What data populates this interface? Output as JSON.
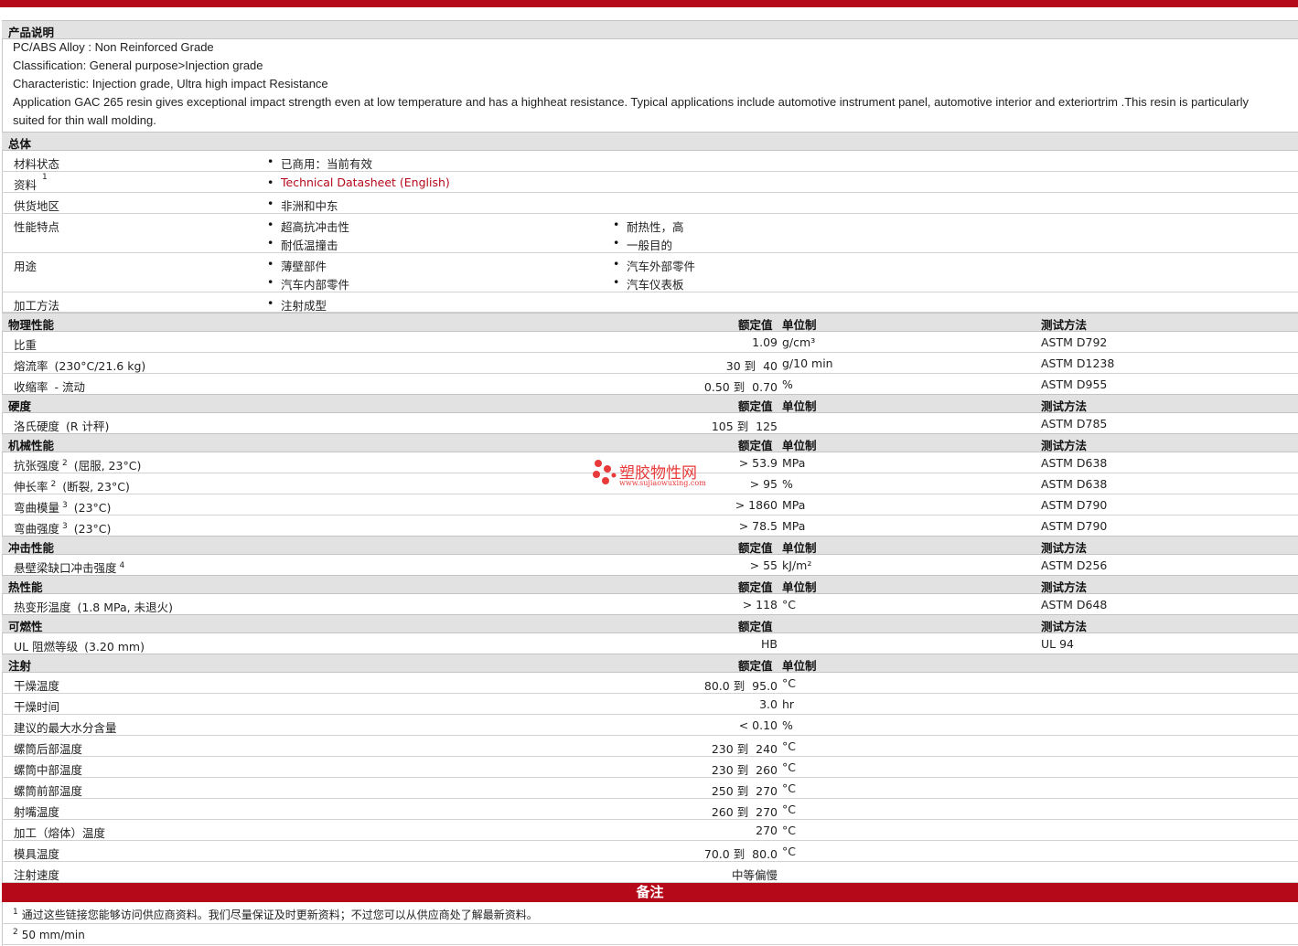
{
  "desc": {
    "header": "产品说明",
    "lines": [
      "PC/ABS Alloy : Non Reinforced Grade",
      "Classification: General purpose>Injection grade",
      "Characteristic: Injection grade, Ultra high impact Resistance",
      "Application GAC 265 resin gives exceptional impact strength even at low temperature and has a highheat resistance. Typical applications include automotive instrument panel, automotive interior and exteriortrim .This resin is particularly",
      "suited for thin wall molding."
    ]
  },
  "general": {
    "header": "总体",
    "rows": [
      {
        "label": "材料状态",
        "items": [
          "已商用：当前有效"
        ]
      },
      {
        "label": "资料",
        "sup": "1",
        "items": [
          "Technical Datasheet (English)"
        ]
      },
      {
        "label": "供货地区",
        "items": [
          "非洲和中东"
        ]
      },
      {
        "label": "性能特点",
        "items": [
          "超高抗冲击性",
          "耐低温撞击",
          "耐热性，高",
          "一般目的"
        ]
      },
      {
        "label": "用途",
        "items": [
          "薄壁部件",
          "汽车内部零件",
          "汽车外部零件",
          "汽车仪表板"
        ]
      },
      {
        "label": "加工方法",
        "items": [
          "注射成型"
        ]
      }
    ]
  },
  "col": {
    "nominal": "额定值",
    "unit": "单位制",
    "method": "测试方法"
  },
  "sections": [
    {
      "name": "物理性能",
      "rows": [
        {
          "label": "比重",
          "sup": "",
          "tail": "",
          "value": "1.09",
          "unit": "g/cm³",
          "method": "ASTM D792"
        },
        {
          "label": "熔流率",
          "sup": "",
          "tail": "(230°C/21.6 kg)",
          "value": "30 到  40",
          "unit": "g/10 min",
          "method": "ASTM D1238"
        },
        {
          "label": "收缩率",
          "sup": "",
          "tail": "- 流动",
          "value": "0.50 到  0.70",
          "unit": "%",
          "method": "ASTM D955"
        }
      ]
    },
    {
      "name": "硬度",
      "rows": [
        {
          "label": "洛氏硬度",
          "sup": "",
          "tail": "(R 计秤)",
          "value": "105 到  125",
          "unit": "",
          "method": "ASTM D785"
        }
      ]
    },
    {
      "name": "机械性能",
      "rows": [
        {
          "label": "抗张强度",
          "sup": "2",
          "tail": "(屈服, 23°C)",
          "value": "> 53.9",
          "unit": "MPa",
          "method": "ASTM D638"
        },
        {
          "label": "伸长率",
          "sup": "2",
          "tail": "(断裂, 23°C)",
          "value": "> 95",
          "unit": "%",
          "method": "ASTM D638"
        },
        {
          "label": "弯曲模量",
          "sup": "3",
          "tail": "(23°C)",
          "value": "> 1860",
          "unit": "MPa",
          "method": "ASTM D790"
        },
        {
          "label": "弯曲强度",
          "sup": "3",
          "tail": "(23°C)",
          "value": "> 78.5",
          "unit": "MPa",
          "method": "ASTM D790"
        }
      ]
    },
    {
      "name": "冲击性能",
      "rows": [
        {
          "label": "悬壁梁缺口冲击强度",
          "sup": "4",
          "tail": "",
          "value": "> 55",
          "unit": "kJ/m²",
          "method": "ASTM D256"
        }
      ]
    },
    {
      "name": "热性能",
      "rows": [
        {
          "label": "热变形温度",
          "sup": "",
          "tail": "(1.8 MPa, 未退火)",
          "value": "> 118",
          "unit": "°C",
          "method": "ASTM D648"
        }
      ]
    },
    {
      "name": "可燃性",
      "no_unit": true,
      "rows": [
        {
          "label": "UL 阻燃等级",
          "sup": "",
          "tail": "(3.20 mm)",
          "value": "HB",
          "unit": "",
          "method": "UL 94"
        }
      ]
    },
    {
      "name": "注射",
      "no_method": true,
      "rows": [
        {
          "label": "干燥温度",
          "sup": "",
          "tail": "",
          "value": "80.0 到  95.0",
          "unit": "°C",
          "method": ""
        },
        {
          "label": "干燥时间",
          "sup": "",
          "tail": "",
          "value": "3.0",
          "unit": "hr",
          "method": ""
        },
        {
          "label": "建议的最大水分含量",
          "sup": "",
          "tail": "",
          "value": "< 0.10",
          "unit": "%",
          "method": ""
        },
        {
          "label": "螺筒后部温度",
          "sup": "",
          "tail": "",
          "value": "230 到  240",
          "unit": "°C",
          "method": ""
        },
        {
          "label": "螺筒中部温度",
          "sup": "",
          "tail": "",
          "value": "230 到  260",
          "unit": "°C",
          "method": ""
        },
        {
          "label": "螺筒前部温度",
          "sup": "",
          "tail": "",
          "value": "250 到  270",
          "unit": "°C",
          "method": ""
        },
        {
          "label": "射嘴温度",
          "sup": "",
          "tail": "",
          "value": "260 到  270",
          "unit": "°C",
          "method": ""
        },
        {
          "label": "加工（熔体）温度",
          "sup": "",
          "tail": "",
          "value": "270",
          "unit": "°C",
          "method": ""
        },
        {
          "label": "模具温度",
          "sup": "",
          "tail": "",
          "value": "70.0 到  80.0",
          "unit": "°C",
          "method": ""
        },
        {
          "label": "注射速度",
          "sup": "",
          "tail": "",
          "value": "中等偏慢",
          "unit": "",
          "method": ""
        }
      ]
    }
  ],
  "notes": {
    "header": "备注",
    "items": [
      {
        "num": "1",
        "text": "通过这些链接您能够访问供应商资料。我们尽量保证及时更新资料；不过您可以从供应商处了解最新资料。"
      },
      {
        "num": "2",
        "text": "50 mm/min"
      }
    ]
  },
  "watermark": {
    "name": "塑胶物性网",
    "url": "www.sujiaowuxing.com",
    "color": "#e83a3a"
  },
  "colors": {
    "accent": "#b5091a",
    "section_bg": "#e2e2e2"
  }
}
